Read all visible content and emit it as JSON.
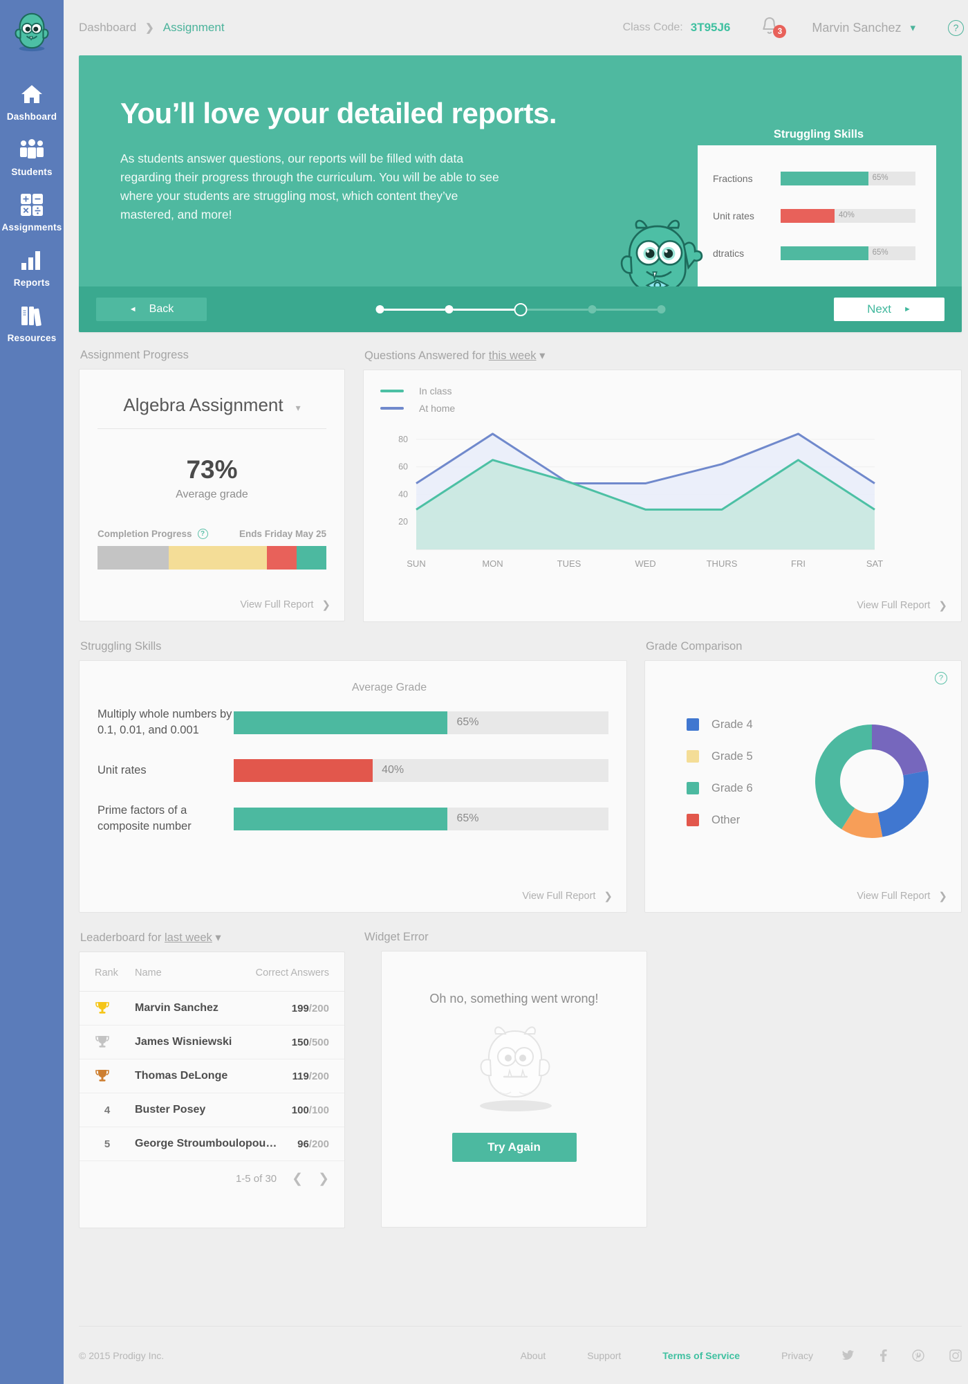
{
  "sidebar": {
    "logo_icon": "prodigy-monster-logo",
    "items": [
      {
        "label": "Dashboard",
        "icon": "home-icon"
      },
      {
        "label": "Students",
        "icon": "people-icon"
      },
      {
        "label": "Assignments",
        "icon": "calculator-icon"
      },
      {
        "label": "Reports",
        "icon": "bar-chart-icon"
      },
      {
        "label": "Resources",
        "icon": "books-icon"
      }
    ]
  },
  "topbar": {
    "breadcrumb_root": "Dashboard",
    "breadcrumb_sep": "❯",
    "breadcrumb_current": "Assignment",
    "class_code_label": "Class Code:",
    "class_code_value": "3T95J6",
    "notifications_count": "3",
    "user_name": "Marvin Sanchez",
    "user_caret": "▾",
    "help_glyph": "?"
  },
  "banner": {
    "title": "You’ll love your detailed reports.",
    "body": "As students answer questions, our reports will be filled with data regarding their progress through the curriculum. You will be able to see where your students are struggling most, which content they’ve mastered, and more!",
    "card_title": "Struggling Skills",
    "card_rows": [
      {
        "name": "Fractions",
        "pct": "65%",
        "value": 65,
        "color": "#4fb9a0"
      },
      {
        "name": "Unit rates",
        "pct": "40%",
        "value": 40,
        "color": "#e8615a"
      },
      {
        "name": "dtratics",
        "pct": "65%",
        "value": 65,
        "color": "#4fb9a0"
      }
    ],
    "back_label": "Back",
    "back_arrow": "◄",
    "next_label": "Next",
    "next_arrow": "►",
    "total_slides": 5,
    "current_slide": 3
  },
  "assignment_progress": {
    "section_label": "Assignment Progress",
    "title": "Algebra Assignment",
    "title_caret": "▾",
    "percent": "73%",
    "percent_sub": "Average grade",
    "completion_label": "Completion Progress",
    "completion_help": "?",
    "ends_label": "Ends Friday May 25",
    "segments": [
      {
        "name": "not-started",
        "pct": 31,
        "color": "#c4c4c4"
      },
      {
        "name": "in-progress",
        "pct": 43,
        "color": "#f4dd97"
      },
      {
        "name": "struggling",
        "pct": 13,
        "color": "#e8615a"
      },
      {
        "name": "completed",
        "pct": 13,
        "color": "#4cb9a0"
      }
    ],
    "view_full_report": "View Full Report",
    "chevron": "❯"
  },
  "questions_chart": {
    "title_prefix": "Questions Answered for",
    "title_range": "this week",
    "title_caret": "▾",
    "view_full_report": "View Full Report",
    "chevron": "❯"
  },
  "struggling_skills": {
    "section_label": "Struggling Skills",
    "column_header": "Average Grade",
    "rows": [
      {
        "name": "Multiply whole numbers by 0.1, 0.01, and 0.001",
        "pct": "65%",
        "value": 65,
        "color": "#4cb9a0"
      },
      {
        "name": "Unit rates",
        "pct": "40%",
        "value": 40,
        "color": "#e2574c"
      },
      {
        "name": "Prime factors of a composite number",
        "pct": "65%",
        "value": 65,
        "color": "#4cb9a0"
      }
    ],
    "view_full_report": "View Full Report",
    "chevron": "❯"
  },
  "grade_comparison": {
    "section_label": "Grade Comparison",
    "help_glyph": "?",
    "view_full_report": "View Full Report",
    "chevron": "❯"
  },
  "leaderboard": {
    "section_label_prefix": "Leaderboard for",
    "section_label_range": "last week",
    "section_label_caret": "▾",
    "columns": {
      "rank": "Rank",
      "name": "Name",
      "correct": "Correct Answers"
    },
    "rows": [
      {
        "rank": "1",
        "medal": "gold-trophy-icon",
        "name": "Marvin Sanchez",
        "correct": "199",
        "total": "/200"
      },
      {
        "rank": "2",
        "medal": "silver-trophy-icon",
        "name": "James Wisniewski",
        "correct": "150",
        "total": "/500"
      },
      {
        "rank": "3",
        "medal": "bronze-trophy-icon",
        "name": "Thomas DeLonge",
        "correct": "119",
        "total": "/200"
      },
      {
        "rank": "4",
        "medal": "",
        "name": "Buster Posey",
        "correct": "100",
        "total": "/100"
      },
      {
        "rank": "5",
        "medal": "",
        "name": "George Stroumboulopou…",
        "correct": "96",
        "total": "/200"
      }
    ],
    "pagination": "1-5 of 30",
    "prev_glyph": "❮",
    "next_glyph": "❯"
  },
  "widget_error": {
    "section_label": "Widget Error",
    "message": "Oh no, something went wrong!",
    "button_label": "Try Again",
    "illustration_icon": "sad-monster-outline-icon"
  },
  "footer": {
    "copyright": "© 2015 Prodigy Inc.",
    "links": [
      {
        "label": "About",
        "active": false
      },
      {
        "label": "Support",
        "active": false
      },
      {
        "label": "Terms of Service",
        "active": true
      },
      {
        "label": "Privacy",
        "active": false
      }
    ],
    "social": [
      {
        "icon": "twitter-icon"
      },
      {
        "icon": "facebook-icon"
      },
      {
        "icon": "pinterest-icon"
      },
      {
        "icon": "instagram-icon"
      }
    ]
  },
  "colors": {
    "brand_teal": "#4fb9a0",
    "brand_teal_dark": "#3aa98f",
    "sidebar_blue": "#5b7cba",
    "danger_red": "#e8615a",
    "warn_yellow": "#f4dd97",
    "page_bg": "#eeeeee"
  },
  "chart_data": [
    {
      "type": "area",
      "title": "Questions Answered for this week",
      "categories": [
        "SUN",
        "MON",
        "TUES",
        "WED",
        "THURS",
        "FRI",
        "SAT"
      ],
      "series": [
        {
          "name": "At home",
          "values": [
            48,
            84,
            48,
            48,
            62,
            84,
            48
          ],
          "color": "#7089cc"
        },
        {
          "name": "In class",
          "values": [
            29,
            65,
            49,
            29,
            29,
            65,
            29
          ],
          "color": "#4cc0a4"
        }
      ],
      "ylim": [
        0,
        90
      ],
      "yticks": [
        20,
        40,
        60,
        80
      ],
      "xlabel": "",
      "ylabel": "",
      "grid": true,
      "legend_position": "top-left"
    },
    {
      "type": "bar",
      "title": "Struggling Skills",
      "orientation": "horizontal",
      "categories": [
        "Multiply whole numbers by 0.1, 0.01, and 0.001",
        "Unit rates",
        "Prime factors of a composite number"
      ],
      "values": [
        65,
        40,
        65
      ],
      "value_labels": [
        "65%",
        "40%",
        "65%"
      ],
      "colors": [
        "#4cb9a0",
        "#e2574c",
        "#4cb9a0"
      ],
      "xlabel": "Average Grade",
      "ylabel": "",
      "xlim": [
        0,
        100
      ],
      "grid": false
    },
    {
      "type": "pie",
      "title": "Grade Comparison",
      "donut": true,
      "labels": [
        "Grade 4",
        "Grade 5",
        "Grade 6",
        "Other"
      ],
      "legend_colors": [
        "#4077d0",
        "#f4dd97",
        "#4cb9a0",
        "#e2574c"
      ],
      "slices": [
        {
          "name": "purple-slice",
          "value": 22,
          "color": "#7667bd"
        },
        {
          "name": "Grade 4",
          "value": 25,
          "color": "#4077d0"
        },
        {
          "name": "orange-slice",
          "value": 12,
          "color": "#f79e58"
        },
        {
          "name": "Grade 6",
          "value": 41,
          "color": "#4cb9a0"
        }
      ],
      "legend_position": "left"
    },
    {
      "type": "bar",
      "title": "Completion Progress",
      "orientation": "stacked-horizontal",
      "categories": [
        "Completion Progress"
      ],
      "series": [
        {
          "name": "not-started",
          "values": [
            31
          ],
          "color": "#c4c4c4"
        },
        {
          "name": "in-progress",
          "values": [
            43
          ],
          "color": "#f4dd97"
        },
        {
          "name": "struggling",
          "values": [
            13
          ],
          "color": "#e8615a"
        },
        {
          "name": "completed",
          "values": [
            13
          ],
          "color": "#4cb9a0"
        }
      ],
      "xlim": [
        0,
        100
      ]
    }
  ]
}
